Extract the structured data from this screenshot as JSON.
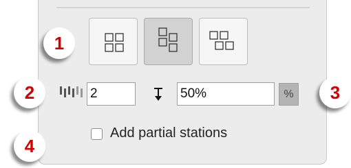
{
  "callouts": [
    "1",
    "2",
    "3",
    "4"
  ],
  "layout_buttons": [
    {
      "icon": "grid-2x2-layout-icon",
      "selected": false
    },
    {
      "icon": "staggered-vertical-layout-icon",
      "selected": true
    },
    {
      "icon": "staggered-horizontal-layout-icon",
      "selected": false
    }
  ],
  "spacing": {
    "icon": "station-spacing-icon",
    "value": "2"
  },
  "offset": {
    "icon": "down-arrow-icon",
    "value": "50%",
    "unit_label": "%"
  },
  "partial_stations": {
    "label": "Add partial stations",
    "checked": false
  }
}
